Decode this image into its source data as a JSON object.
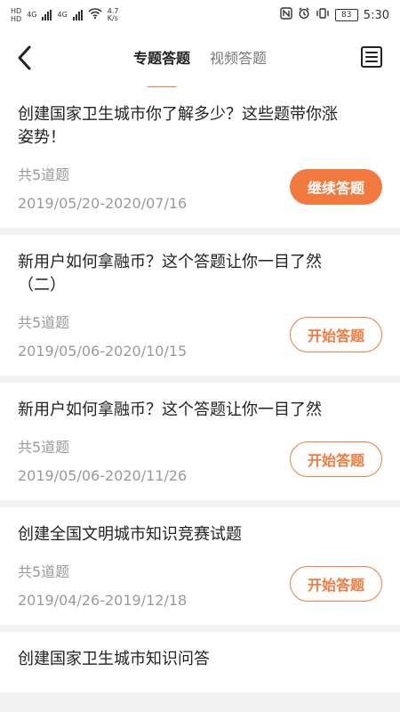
{
  "statusbar": {
    "left_hd_1": "HD",
    "left_hd_2": "HD",
    "net_1": "4G",
    "net_2": "4G",
    "speed_value": "4.7",
    "speed_unit": "K/s",
    "battery": "83",
    "time": "5:30"
  },
  "header": {
    "tabs": [
      {
        "label": "专题答题",
        "active": true
      },
      {
        "label": "视频答题",
        "active": false
      }
    ]
  },
  "cards": [
    {
      "title": "创建国家卫生城市你了解多少？这些题带你涨\n姿势！",
      "count": "共5道题",
      "date": "2019/05/20-2020/07/16",
      "button": "继续答题",
      "style": "primary"
    },
    {
      "title": "新用户如何拿融币？这个答题让你一目了然\n（二）",
      "count": "共5道题",
      "date": "2019/05/06-2020/10/15",
      "button": "开始答题",
      "style": "outline"
    },
    {
      "title": "新用户如何拿融币？这个答题让你一目了然",
      "count": "共5道题",
      "date": "2019/05/06-2020/11/26",
      "button": "开始答题",
      "style": "outline"
    },
    {
      "title": "创建全国文明城市知识竞赛试题",
      "count": "共5道题",
      "date": "2019/04/26-2019/12/18",
      "button": "开始答题",
      "style": "outline"
    },
    {
      "title": "创建国家卫生城市知识问答",
      "count": "",
      "date": "",
      "button": "",
      "style": "none"
    }
  ],
  "colors": {
    "accent": "#f27a3f"
  }
}
